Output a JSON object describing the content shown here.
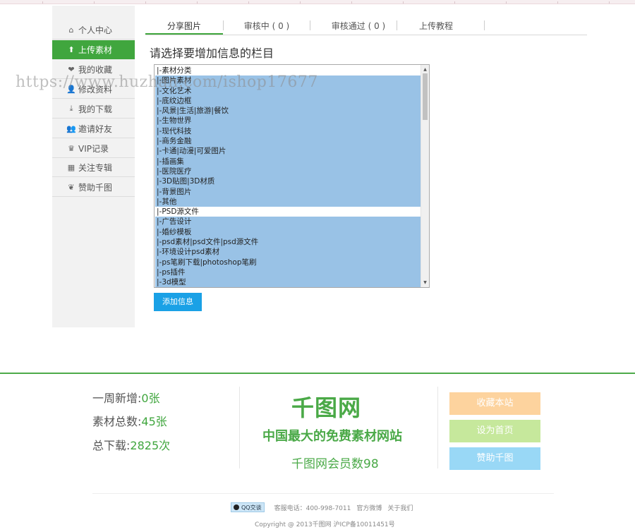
{
  "sidebar": {
    "items": [
      {
        "icon": "home-icon",
        "glyph": "⌂",
        "label": "个人中心",
        "active": false
      },
      {
        "icon": "upload-icon",
        "glyph": "⬆",
        "label": "上传素材",
        "active": true
      },
      {
        "icon": "heart-icon",
        "glyph": "❤",
        "label": "我的收藏",
        "active": false
      },
      {
        "icon": "user-icon",
        "glyph": "👤",
        "label": "修改资料",
        "active": false
      },
      {
        "icon": "download-icon",
        "glyph": "⤓",
        "label": "我的下载",
        "active": false
      },
      {
        "icon": "users-icon",
        "glyph": "👥",
        "label": "邀请好友",
        "active": false
      },
      {
        "icon": "crown-icon",
        "glyph": "♛",
        "label": "VIP记录",
        "active": false
      },
      {
        "icon": "calculator-icon",
        "glyph": "▦",
        "label": "关注专辑",
        "active": false
      },
      {
        "icon": "sponsor-icon",
        "glyph": "❦",
        "label": "赞助千图",
        "active": false
      }
    ]
  },
  "tabs": [
    {
      "label": "分享图片",
      "active": true
    },
    {
      "label": "审核中 ( 0 )",
      "active": false
    },
    {
      "label": "审核通过 ( 0 )",
      "active": false
    },
    {
      "label": "上传教程",
      "active": false
    }
  ],
  "heading": "请选择要增加信息的栏目",
  "category_list": [
    {
      "label": "|-素材分类",
      "selected": false
    },
    {
      "label": "|-图片素材",
      "selected": true
    },
    {
      "label": "|-文化艺术",
      "selected": true
    },
    {
      "label": "|-底纹边框",
      "selected": true
    },
    {
      "label": "|-风景|生活|旅游|餐饮",
      "selected": true
    },
    {
      "label": "|-生物世界",
      "selected": true
    },
    {
      "label": "|-现代科技",
      "selected": true
    },
    {
      "label": "|-商务金融",
      "selected": true
    },
    {
      "label": "|-卡通|动漫|可爱图片",
      "selected": true
    },
    {
      "label": "|-插画集",
      "selected": true
    },
    {
      "label": "|-医院医疗",
      "selected": true
    },
    {
      "label": "|-3D贴图|3D材质",
      "selected": true
    },
    {
      "label": "|-背景图片",
      "selected": true
    },
    {
      "label": "|-其他",
      "selected": true
    },
    {
      "label": "|-PSD源文件",
      "selected": false
    },
    {
      "label": "|-广告设计",
      "selected": true
    },
    {
      "label": "|-婚纱模板",
      "selected": true
    },
    {
      "label": "|-psd素材|psd文件|psd源文件",
      "selected": true
    },
    {
      "label": "|-环境设计psd素材",
      "selected": true
    },
    {
      "label": "|-ps笔刷下载|photoshop笔刷",
      "selected": true
    },
    {
      "label": "|-ps插件",
      "selected": true
    },
    {
      "label": "|-3d模型",
      "selected": true
    }
  ],
  "add_button": "添加信息",
  "watermark": "https://www.huzhan.com/ishop17677",
  "footer": {
    "stats": [
      {
        "label": "一周新增:",
        "value": "0张"
      },
      {
        "label": "素材总数:",
        "value": "45张"
      },
      {
        "label": "总下载:",
        "value": "2825次"
      }
    ],
    "logo": "千图网",
    "slogan": "中国最大的免费素材网站",
    "members": "千图网会员数98",
    "buttons": [
      {
        "label": "收藏本站",
        "color": "#fdd39e"
      },
      {
        "label": "设为首页",
        "color": "#c6e89c"
      },
      {
        "label": "赞助千图",
        "color": "#99d8f6"
      }
    ],
    "qq_label": "QQ交谈",
    "phone": "客服电话：400-998-7011",
    "links": [
      "官方微博",
      "关于我们"
    ],
    "copyright": "Copyright @ 2013千图网 沪ICP备10011451号"
  }
}
